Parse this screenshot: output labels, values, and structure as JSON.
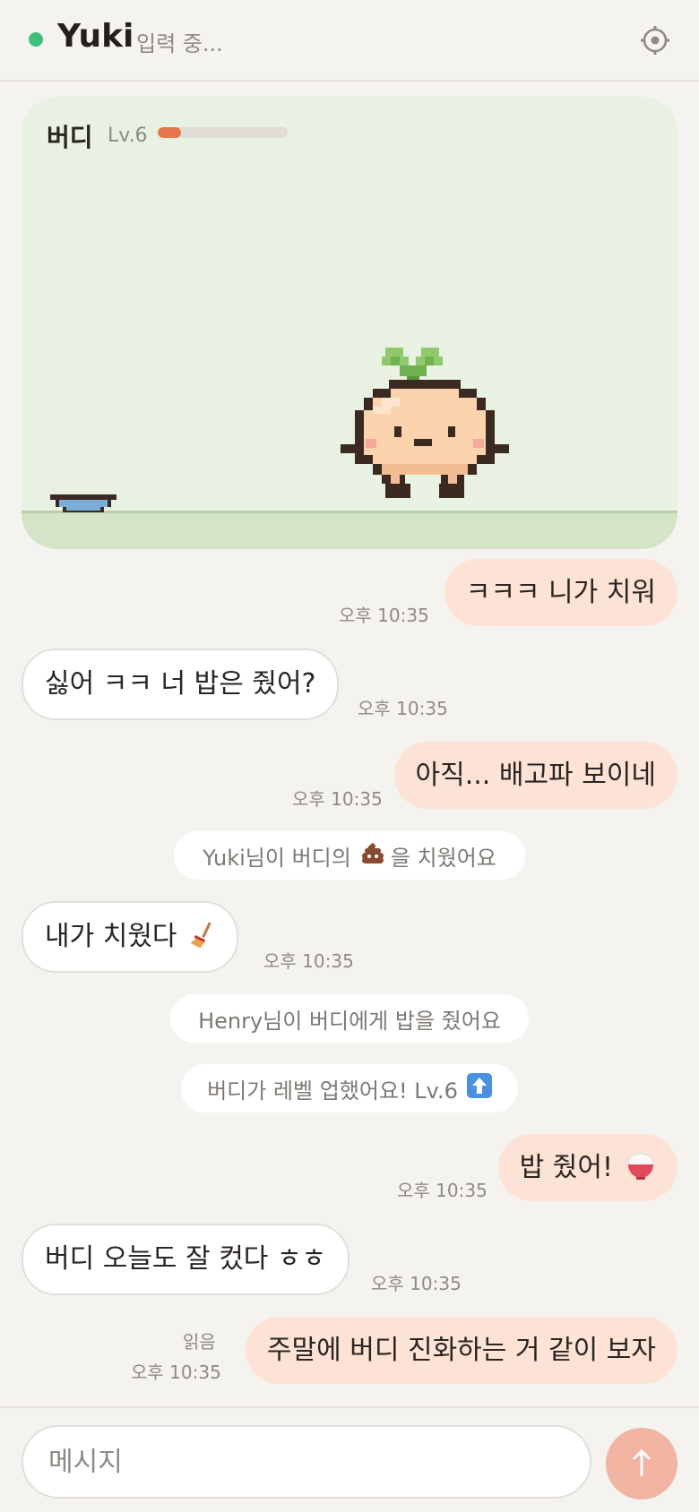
{
  "header": {
    "name": "Yuki",
    "status": "입력 중...",
    "settings_icon": "gear-icon"
  },
  "pet": {
    "name": "버디",
    "level": "Lv.6",
    "xp_fraction": 0.18,
    "bowl_icon": "food-bowl-icon",
    "sprite_icon": "onion-pet-sprite"
  },
  "messages": [
    {
      "side": "out",
      "text": "ㅋㅋㅋ 니가 치워",
      "time": "오후 10:35"
    },
    {
      "side": "in",
      "text": "싫어 ㅋㅋ 너 밥은 줬어?",
      "time": "오후 10:35"
    },
    {
      "side": "out",
      "text": "아직... 배고파 보이네",
      "time": "오후 10:35"
    },
    {
      "side": "system",
      "text_before": "Yuki님이 버디의",
      "icon": "poop-icon",
      "text_after": "을 치웠어요"
    },
    {
      "side": "in",
      "text": "내가 치웠다",
      "icon": "broom-icon",
      "time": "오후 10:35"
    },
    {
      "side": "system",
      "text": "Henry님이 버디에게 밥을 줬어요"
    },
    {
      "side": "system",
      "text": "버디가 레벨 업했어요! Lv.6",
      "icon": "up-arrow-icon"
    },
    {
      "side": "out",
      "text": "밥 줬어!",
      "icon": "rice-bowl-icon",
      "time": "오후 10:35"
    },
    {
      "side": "in",
      "text": "버디 오늘도 잘 컸다 ㅎㅎ",
      "time": "오후 10:35"
    },
    {
      "side": "out",
      "text": "주말에 버디 진화하는 거 같이 보자",
      "time": "오후 10:35",
      "read": "읽음"
    }
  ],
  "composer": {
    "placeholder": "메시지",
    "send_icon": "send-arrow-icon"
  },
  "colors": {
    "accent": "#e8764a",
    "outgoing_bubble": "#fde2d6",
    "online": "#3cc07a",
    "card_bg": "#e9f1e2"
  }
}
